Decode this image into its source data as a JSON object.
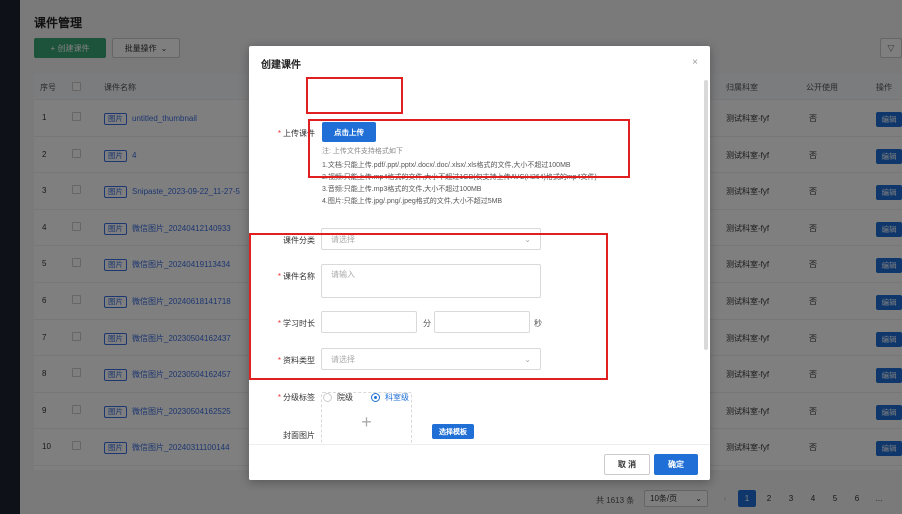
{
  "page": {
    "title": "课件管理",
    "create_btn": "+ 创建课件",
    "batch_btn": "批量操作",
    "filter_icon": "filter-icon"
  },
  "table": {
    "headers": {
      "index": "序号",
      "name": "课件名称",
      "dept": "归属科室",
      "public": "公开使用",
      "action": "操作"
    },
    "rows": [
      {
        "no": "1",
        "tag": "图片",
        "name": "untitled_thumbnail",
        "dept": "测试科室-fyf",
        "public": "否",
        "action": "编辑"
      },
      {
        "no": "2",
        "tag": "图片",
        "name": "4",
        "dept": "测试科室-fyf",
        "public": "否",
        "action": "编辑"
      },
      {
        "no": "3",
        "tag": "图片",
        "name": "Snipaste_2023-09-22_11-27-5",
        "dept": "测试科室-fyf",
        "public": "否",
        "action": "编辑"
      },
      {
        "no": "4",
        "tag": "图片",
        "name": "微信图片_20240412140933",
        "dept": "测试科室-fyf",
        "public": "否",
        "action": "编辑"
      },
      {
        "no": "5",
        "tag": "图片",
        "name": "微信图片_20240419113434",
        "dept": "测试科室-fyf",
        "public": "否",
        "action": "编辑"
      },
      {
        "no": "6",
        "tag": "图片",
        "name": "微信图片_20240618141718",
        "dept": "测试科室-fyf",
        "public": "否",
        "action": "编辑"
      },
      {
        "no": "7",
        "tag": "图片",
        "name": "微信图片_20230504162437",
        "dept": "测试科室-fyf",
        "public": "否",
        "action": "编辑"
      },
      {
        "no": "8",
        "tag": "图片",
        "name": "微信图片_20230504162457",
        "dept": "测试科室-fyf",
        "public": "否",
        "action": "编辑"
      },
      {
        "no": "9",
        "tag": "图片",
        "name": "微信图片_20230504162525",
        "dept": "测试科室-fyf",
        "public": "否",
        "action": "编辑"
      },
      {
        "no": "10",
        "tag": "图片",
        "name": "微信图片_20240311100144",
        "dept": "测试科室-fyf",
        "public": "否",
        "action": "编辑"
      }
    ]
  },
  "pager": {
    "total": "共 1613 条",
    "page_size": "10条/页",
    "pages": [
      "1",
      "2",
      "3",
      "4",
      "5",
      "6",
      "..."
    ],
    "current": "1"
  },
  "dialog": {
    "title": "创建课件",
    "close": "×",
    "upload_label": "上传课件",
    "upload_btn": "点击上传",
    "note_head": "注: 上传文件支持格式如下",
    "notes": [
      "1.文档:只能上传.pdf/.ppt/.pptx/.docx/.doc/.xlsx/.xls格式的文件,大小不超过100MB",
      "2.视频:只能上传.mp4格式的文件,大小不超过1GB(仅支持上传AVC(H264)格式的mp4文件)",
      "3.音频:只能上传.mp3格式的文件,大小不超过100MB",
      "4.图片:只能上传.jpg/.png/.jpeg格式的文件,大小不超过5MB"
    ],
    "category_label": "课件分类",
    "category_placeholder": "请选择",
    "name_label": "课件名称",
    "name_placeholder": "请输入",
    "duration_label": "学习时长",
    "minute_unit": "分",
    "second_unit": "秒",
    "type_label": "资料类型",
    "type_placeholder": "请选择",
    "level_label": "分级标签",
    "level_options": [
      "院级",
      "科室级"
    ],
    "level_selected": "科室级",
    "cover_label": "封面图片",
    "cover_plus": "+",
    "template_btn": "选择模板",
    "cancel_btn": "取 消",
    "ok_btn": "确定"
  },
  "colors": {
    "primary": "#1f6fd6",
    "create_green": "#3ba776",
    "annotation_red": "#e02020",
    "required_star": "#e33"
  }
}
